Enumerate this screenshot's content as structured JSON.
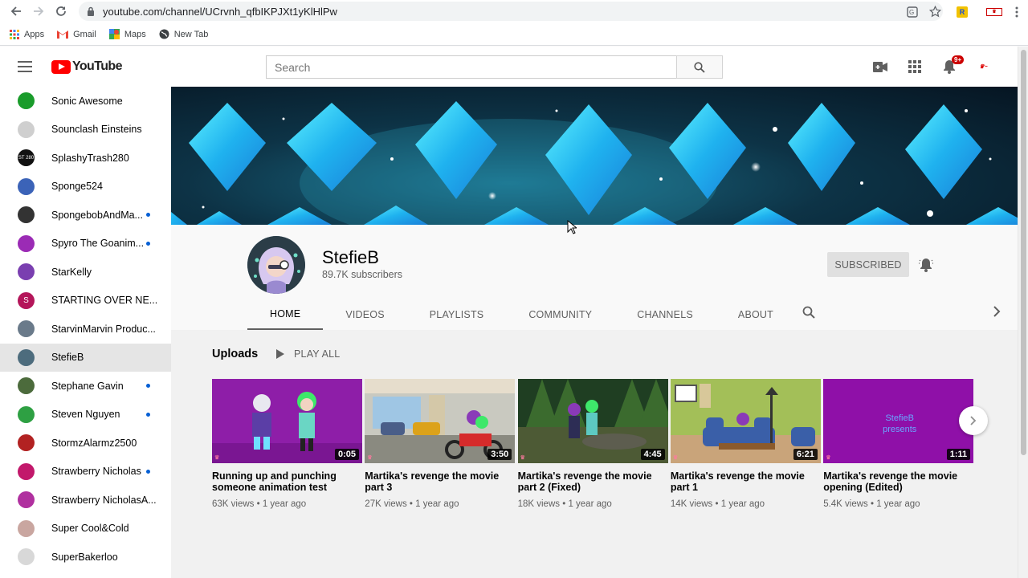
{
  "browser": {
    "url": "youtube.com/channel/UCrvnh_qfbIKPJXt1yKlHlPw",
    "bookmarks": [
      {
        "label": "Apps",
        "icon": "apps-grid-icon"
      },
      {
        "label": "Gmail",
        "icon": "gmail-icon"
      },
      {
        "label": "Maps",
        "icon": "maps-icon"
      },
      {
        "label": "New Tab",
        "icon": "globe-icon"
      }
    ]
  },
  "masthead": {
    "logo": "YouTube",
    "search_placeholder": "Search",
    "notification_count": "9+",
    "colors": {
      "brand": "#ff0000",
      "badge": "#cc0000"
    }
  },
  "sidebar": {
    "items": [
      {
        "label": "Sonic Awesome",
        "new": false,
        "color": "#1a9c2b"
      },
      {
        "label": "Sounclash Einsteins",
        "new": false,
        "color": "#cfcfcf"
      },
      {
        "label": "SplashyTrash280",
        "new": false,
        "color": "#111111",
        "initials": "ST 280"
      },
      {
        "label": "Sponge524",
        "new": false,
        "color": "#3b63b8"
      },
      {
        "label": "SpongebobAndMa...",
        "new": true,
        "color": "#333333"
      },
      {
        "label": "Spyro The Goanim...",
        "new": true,
        "color": "#9b2bb5"
      },
      {
        "label": "StarKelly",
        "new": false,
        "color": "#7a3fb0"
      },
      {
        "label": "STARTING OVER NE...",
        "new": false,
        "color": "#b4165a",
        "initials": "S"
      },
      {
        "label": "StarvinMarvin Produc...",
        "new": false,
        "color": "#6a7a8a"
      },
      {
        "label": "StefieB",
        "new": false,
        "color": "#4d6c7d",
        "active": true
      },
      {
        "label": "Stephane Gavin",
        "new": true,
        "color": "#4c6b3c"
      },
      {
        "label": "Steven Nguyen",
        "new": true,
        "color": "#2ea043"
      },
      {
        "label": "StormzAlarmz2500",
        "new": false,
        "color": "#b22222"
      },
      {
        "label": "Strawberry Nicholas",
        "new": true,
        "color": "#c2186b"
      },
      {
        "label": "Strawberry NicholasA...",
        "new": false,
        "color": "#b0309f"
      },
      {
        "label": "Super Cool&Cold",
        "new": false,
        "color": "#c9a6a0"
      },
      {
        "label": "SuperBakerloo",
        "new": false,
        "color": "#d8d8d8"
      }
    ]
  },
  "channel": {
    "name": "StefieB",
    "subscribers": "89.7K subscribers",
    "subscribe_label": "SUBSCRIBED",
    "tabs": [
      "HOME",
      "VIDEOS",
      "PLAYLISTS",
      "COMMUNITY",
      "CHANNELS",
      "ABOUT"
    ],
    "active_tab": "HOME"
  },
  "uploads": {
    "title": "Uploads",
    "play_all": "PLAY ALL",
    "videos": [
      {
        "title": "Running up and punching someone animation test",
        "views": "63K views",
        "age": "1 year ago",
        "duration": "0:05",
        "bg": "#8e1ea8"
      },
      {
        "title": "Martika's revenge the movie part 3",
        "views": "27K views",
        "age": "1 year ago",
        "duration": "3:50",
        "bg": "#8a8a80"
      },
      {
        "title": "Martika's revenge the movie part 2 (Fixed)",
        "views": "18K views",
        "age": "1 year ago",
        "duration": "4:45",
        "bg": "#2f5a2c"
      },
      {
        "title": "Martika's revenge the movie part 1",
        "views": "14K views",
        "age": "1 year ago",
        "duration": "6:21",
        "bg": "#9ab54a"
      },
      {
        "title": "Martika's revenge the movie opening (Edited)",
        "views": "5.4K views",
        "age": "1 year ago",
        "duration": "1:11",
        "bg": "#8f10a8",
        "overlay": "StefieB presents"
      }
    ]
  }
}
